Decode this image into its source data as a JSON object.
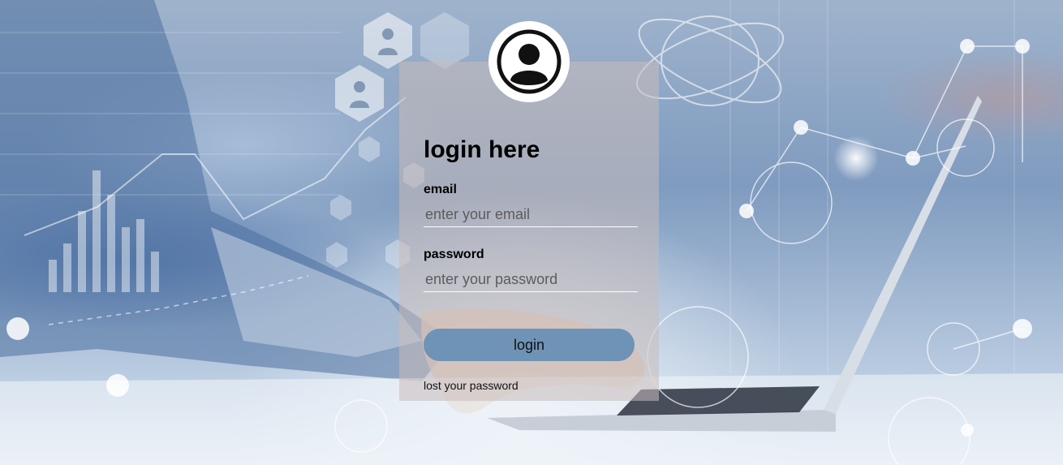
{
  "login_form": {
    "title": "login here",
    "email": {
      "label": "email",
      "placeholder": "enter your email",
      "value": ""
    },
    "password": {
      "label": "password",
      "placeholder": "enter your password",
      "value": ""
    },
    "submit_label": "login",
    "lost_password_link": "lost your password"
  },
  "icons": {
    "avatar": "user-circle-icon"
  },
  "colors": {
    "button": "#6f93b6",
    "panel": "#c8bcba",
    "field_underline": "#ffffff"
  }
}
